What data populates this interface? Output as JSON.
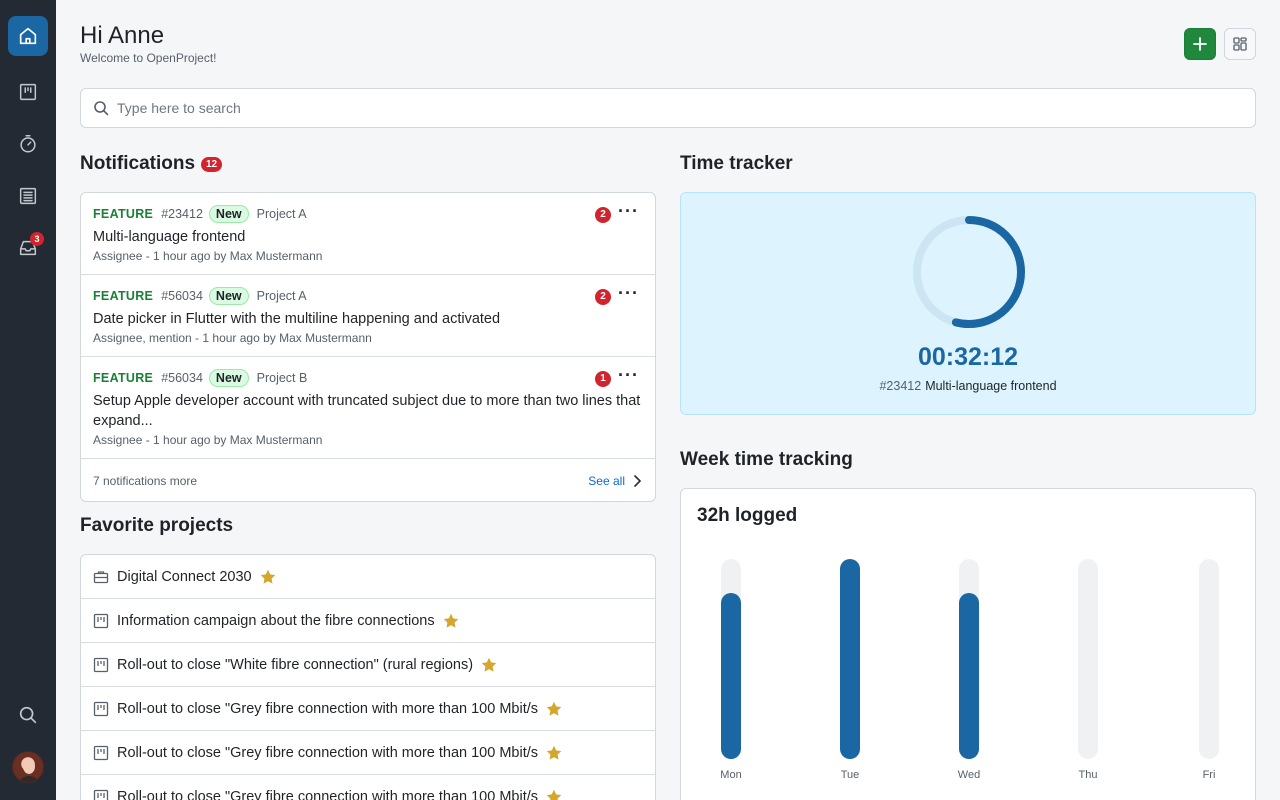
{
  "sidebar": {
    "items": [
      {
        "name": "home",
        "icon": "home-icon",
        "active": true
      },
      {
        "name": "boards",
        "icon": "board-icon"
      },
      {
        "name": "time",
        "icon": "stopwatch-icon"
      },
      {
        "name": "list",
        "icon": "list-icon"
      },
      {
        "name": "inbox",
        "icon": "inbox-icon",
        "badge": "3"
      }
    ],
    "bottom": [
      {
        "name": "search",
        "icon": "search-icon"
      },
      {
        "name": "avatar",
        "icon": "avatar"
      }
    ]
  },
  "header": {
    "title": "Hi Anne",
    "subtitle": "Welcome to OpenProject!"
  },
  "search": {
    "placeholder": "Type here to search"
  },
  "notifications": {
    "title": "Notifications",
    "count": "12",
    "items": [
      {
        "type": "FEATURE",
        "id": "#23412",
        "status": "New",
        "project": "Project A",
        "subject": "Multi-language frontend",
        "info": "Assignee - 1 hour ago by Max Mustermann",
        "count": "2"
      },
      {
        "type": "FEATURE",
        "id": "#56034",
        "status": "New",
        "project": "Project A",
        "subject": "Date picker in Flutter with the multiline happening and activated",
        "info": "Assignee, mention - 1 hour ago by Max Mustermann",
        "count": "2"
      },
      {
        "type": "FEATURE",
        "id": "#56034",
        "status": "New",
        "project": "Project B",
        "subject": "Setup Apple developer account with truncated subject due to more than two lines that expand...",
        "info": "Assignee - 1 hour ago by Max Mustermann",
        "count": "1"
      }
    ],
    "more_text": "7 notifications more",
    "see_all": "See all"
  },
  "favorites": {
    "title": "Favorite projects",
    "items": [
      {
        "name": "Digital Connect 2030",
        "icon": "briefcase-icon"
      },
      {
        "name": "Information campaign about the fibre connections",
        "icon": "board-icon"
      },
      {
        "name": "Roll-out to close \"White fibre connection\" (rural regions)",
        "icon": "board-icon"
      },
      {
        "name": "Roll-out to close \"Grey fibre connection with more than 100 Mbit/s",
        "icon": "board-icon"
      },
      {
        "name": "Roll-out to close \"Grey fibre connection with more than 100 Mbit/s",
        "icon": "board-icon"
      },
      {
        "name": "Roll-out to close \"Grey fibre connection with more than 100 Mbit/s",
        "icon": "board-icon"
      }
    ]
  },
  "time_tracker": {
    "title": "Time tracker",
    "time": "00:32:12",
    "task_id": "#23412",
    "task_name": "Multi-language frontend",
    "progress": 0.54
  },
  "week": {
    "title": "Week time tracking",
    "total": "32h logged"
  },
  "chart_data": {
    "type": "bar",
    "categories": [
      "Mon",
      "Tue",
      "Wed",
      "Thu",
      "Fri"
    ],
    "values": [
      0.83,
      1.0,
      0.83,
      0,
      0
    ],
    "ylim": [
      0,
      1
    ]
  },
  "colors": {
    "primary": "#1a67a3",
    "success": "#1f883d",
    "danger": "#d1242f",
    "star": "#d4a72c",
    "sidebar": "#232a33"
  }
}
